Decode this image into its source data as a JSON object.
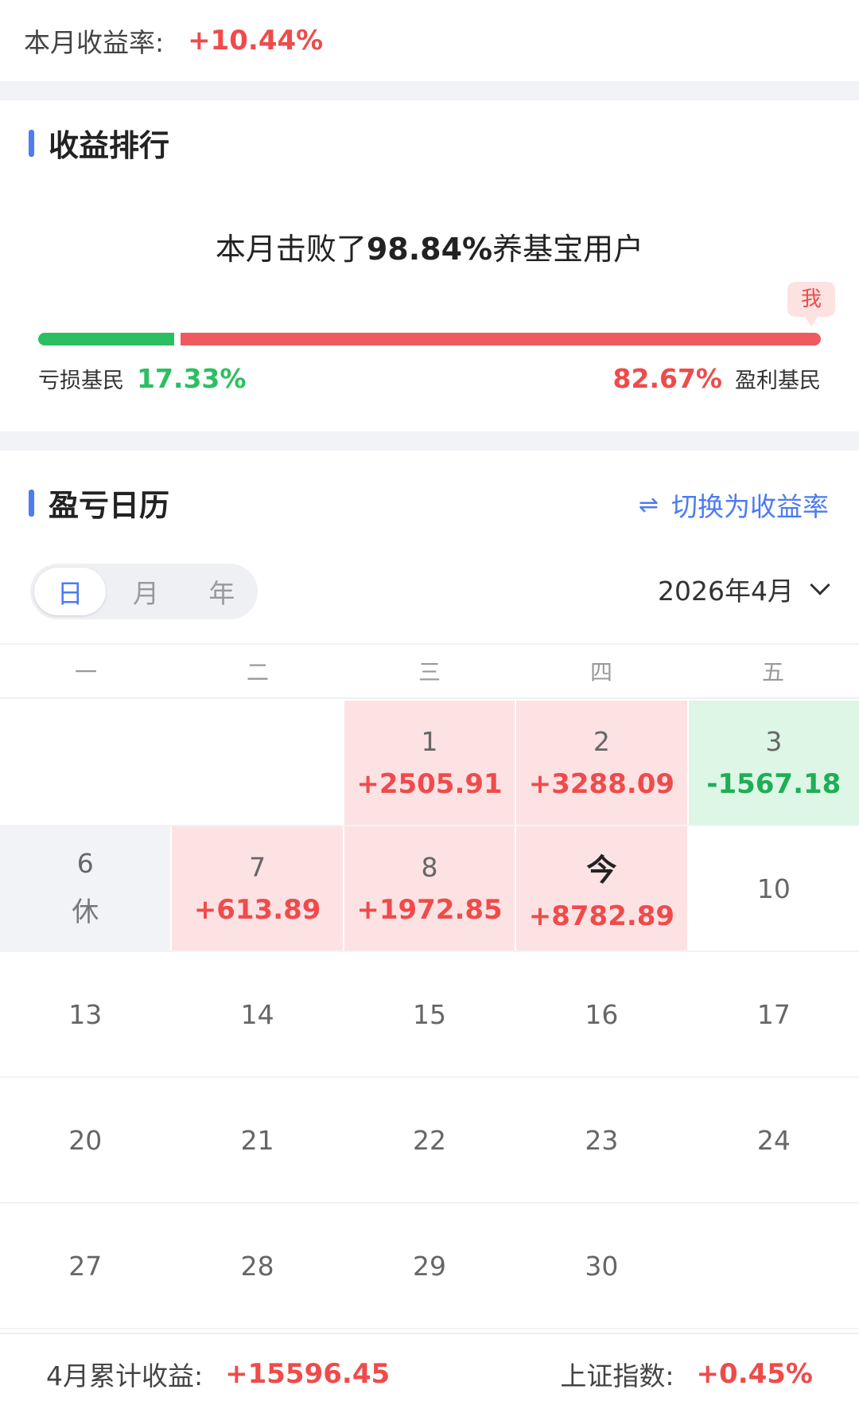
{
  "top": {
    "label": "本月收益率:",
    "value": "+10.44%"
  },
  "ranking": {
    "title": "收益排行",
    "beat_prefix": "本月击败了",
    "beat_percent": "98.84%",
    "beat_suffix": "养基宝用户",
    "me_label": "我",
    "loss_label": "亏损基民",
    "loss_percent": "17.33%",
    "loss_fraction": 0.1733,
    "gain_percent": "82.67%",
    "gain_label": "盈利基民",
    "colors": {
      "gain": "#ef4b4b",
      "loss": "#2cbf62",
      "accent": "#4c7bf2"
    }
  },
  "calendar": {
    "title": "盈亏日历",
    "switch_label": "切换为收益率",
    "switch_icon": "swap-arrows-icon",
    "tabs": [
      {
        "label": "日",
        "active": true
      },
      {
        "label": "月",
        "active": false
      },
      {
        "label": "年",
        "active": false
      }
    ],
    "month": "2026年4月",
    "weekdays": [
      "一",
      "二",
      "三",
      "四",
      "五"
    ],
    "weeks": [
      [
        {
          "day": "",
          "value": "",
          "type": "empty"
        },
        {
          "day": "",
          "value": "",
          "type": "empty"
        },
        {
          "day": "1",
          "value": "+2505.91",
          "type": "gain"
        },
        {
          "day": "2",
          "value": "+3288.09",
          "type": "gain"
        },
        {
          "day": "3",
          "value": "-1567.18",
          "type": "loss"
        }
      ],
      [
        {
          "day": "6",
          "value": "休",
          "type": "rest"
        },
        {
          "day": "7",
          "value": "+613.89",
          "type": "gain"
        },
        {
          "day": "8",
          "value": "+1972.85",
          "type": "gain"
        },
        {
          "day": "今",
          "value": "+8782.89",
          "type": "gain",
          "today": true
        },
        {
          "day": "10",
          "value": "",
          "type": "plain"
        }
      ],
      [
        {
          "day": "13",
          "value": "",
          "type": "plain"
        },
        {
          "day": "14",
          "value": "",
          "type": "plain"
        },
        {
          "day": "15",
          "value": "",
          "type": "plain"
        },
        {
          "day": "16",
          "value": "",
          "type": "plain"
        },
        {
          "day": "17",
          "value": "",
          "type": "plain"
        }
      ],
      [
        {
          "day": "20",
          "value": "",
          "type": "plain"
        },
        {
          "day": "21",
          "value": "",
          "type": "plain"
        },
        {
          "day": "22",
          "value": "",
          "type": "plain"
        },
        {
          "day": "23",
          "value": "",
          "type": "plain"
        },
        {
          "day": "24",
          "value": "",
          "type": "plain"
        }
      ],
      [
        {
          "day": "27",
          "value": "",
          "type": "plain"
        },
        {
          "day": "28",
          "value": "",
          "type": "plain"
        },
        {
          "day": "29",
          "value": "",
          "type": "plain"
        },
        {
          "day": "30",
          "value": "",
          "type": "plain"
        },
        {
          "day": "",
          "value": "",
          "type": "empty"
        }
      ]
    ],
    "footer": {
      "total_label": "4月累计收益:",
      "total_value": "+15596.45",
      "index_label": "上证指数:",
      "index_value": "+0.45%"
    }
  }
}
